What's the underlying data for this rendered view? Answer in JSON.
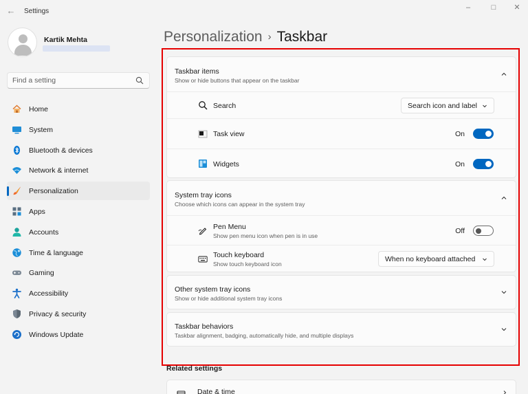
{
  "window": {
    "title": "Settings",
    "back_glyph": "←",
    "minimize_glyph": "–",
    "maximize_glyph": "□",
    "close_glyph": "✕"
  },
  "profile": {
    "name": "Kartik Mehta"
  },
  "search": {
    "placeholder": "Find a setting"
  },
  "sidebar": {
    "items": [
      {
        "label": "Home",
        "icon": "home-icon"
      },
      {
        "label": "System",
        "icon": "system-icon"
      },
      {
        "label": "Bluetooth & devices",
        "icon": "bluetooth-icon"
      },
      {
        "label": "Network & internet",
        "icon": "wifi-icon"
      },
      {
        "label": "Personalization",
        "icon": "brush-icon",
        "active": true
      },
      {
        "label": "Apps",
        "icon": "apps-icon"
      },
      {
        "label": "Accounts",
        "icon": "accounts-icon"
      },
      {
        "label": "Time & language",
        "icon": "globe-icon"
      },
      {
        "label": "Gaming",
        "icon": "gamepad-icon"
      },
      {
        "label": "Accessibility",
        "icon": "accessibility-icon"
      },
      {
        "label": "Privacy & security",
        "icon": "shield-icon"
      },
      {
        "label": "Windows Update",
        "icon": "update-icon"
      }
    ]
  },
  "header": {
    "parent": "Personalization",
    "separator": "›",
    "current": "Taskbar"
  },
  "taskbar_items": {
    "title": "Taskbar items",
    "subtitle": "Show or hide buttons that appear on the taskbar",
    "search": {
      "label": "Search",
      "value": "Search icon and label"
    },
    "task_view": {
      "label": "Task view",
      "state": "On"
    },
    "widgets": {
      "label": "Widgets",
      "state": "On"
    }
  },
  "system_tray": {
    "title": "System tray icons",
    "subtitle": "Choose which icons can appear in the system tray",
    "pen_menu": {
      "label": "Pen Menu",
      "subtitle": "Show pen menu icon when pen is in use",
      "state": "Off"
    },
    "touch_keyboard": {
      "label": "Touch keyboard",
      "subtitle": "Show touch keyboard icon",
      "value": "When no keyboard attached"
    }
  },
  "other_tray": {
    "title": "Other system tray icons",
    "subtitle": "Show or hide additional system tray icons"
  },
  "behaviors": {
    "title": "Taskbar behaviors",
    "subtitle": "Taskbar alignment, badging, automatically hide, and multiple displays"
  },
  "related": {
    "title": "Related settings",
    "date_time": "Date & time"
  },
  "colors": {
    "accent": "#0067c0",
    "highlight_border": "#e60000",
    "background": "#f3f3f3",
    "card": "#fbfbfb"
  }
}
